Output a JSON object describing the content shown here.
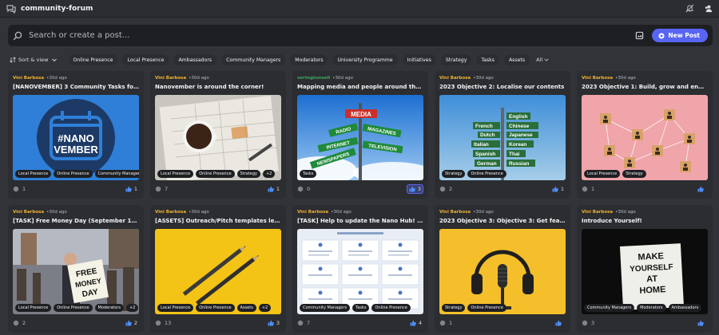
{
  "header": {
    "title": "community-forum"
  },
  "search": {
    "placeholder": "Search or create a post...",
    "new_post_label": "New Post"
  },
  "toolbar": {
    "sort_label": "Sort & view",
    "tags": [
      "Online Presence",
      "Local Presence",
      "Ambassadors",
      "Community Managers",
      "Moderators",
      "University Programme",
      "Initiatives",
      "Strategy",
      "Tasks",
      "Assets"
    ],
    "all_label": "All"
  },
  "posts": [
    {
      "author": "Vini Barbosa",
      "time": "30d ago",
      "title": "[NANOVEMBER] 3 Community Tasks for Everyo...",
      "tags": [
        "Local Presence",
        "Online Presence",
        "Community Managers"
      ],
      "comments": "1",
      "likes": "1",
      "thumb_text": [
        "#NANO",
        "VEMBER"
      ]
    },
    {
      "author": "Vini Barbosa",
      "time": "30d ago",
      "title": "Nanovember is around the corner!",
      "tags": [
        "Local Presence",
        "Online Presence",
        "Strategy",
        "+2"
      ],
      "comments": "7",
      "likes": "1"
    },
    {
      "author": "sertogtunsell",
      "time": "30d ago",
      "title": "Mapping media and people around the world",
      "tags": [
        "Tasks"
      ],
      "comments": "0",
      "likes": "3",
      "thumb_text": [
        "MEDIA",
        "RADIO",
        "MAGAZINES",
        "INTERNET",
        "TELEVISION",
        "NEWSPAPERS"
      ]
    },
    {
      "author": "Vini Barbosa",
      "time": "30d ago",
      "title": "2023 Objective 2: Localise our contents",
      "tags": [
        "Strategy",
        "Online Presence"
      ],
      "comments": "2",
      "likes": "1",
      "thumb_text": [
        "French",
        "English",
        "Chinese",
        "Dutch",
        "Japanese",
        "Italian",
        "Korean",
        "Spanish",
        "Thai",
        "German",
        "Russian"
      ]
    },
    {
      "author": "Vini Barbosa",
      "time": "30d ago",
      "title": "2023 Objective 1: Build, grow and engage your c...",
      "tags": [
        "Local Presence",
        "Strategy"
      ],
      "comments": "1",
      "likes": ""
    },
    {
      "author": "Vini Barbosa",
      "time": "30d ago",
      "title": "[TASK] Free Money Day (September 15, Friday)",
      "tags": [
        "Local Presence",
        "Online Presence",
        "Moderators",
        "+2"
      ],
      "comments": "2",
      "likes": "2",
      "thumb_text": [
        "FREE",
        "MONEY",
        "DAY"
      ]
    },
    {
      "author": "Vini Barbosa",
      "time": "30d ago",
      "title": "[ASSETS] Outreach/Pitch templates lead gener...",
      "tags": [
        "Local Presence",
        "Online Presence",
        "Assets",
        "+2"
      ],
      "comments": "13",
      "likes": "3"
    },
    {
      "author": "Vini Barbosa",
      "time": "30d ago",
      "title": "[TASK] Help to update the Nano Hub! (see how)",
      "tags": [
        "Community Managers",
        "Tasks",
        "Online Presence"
      ],
      "comments": "7",
      "likes": "4"
    },
    {
      "author": "Vini Barbosa",
      "time": "30d ago",
      "title": "2023 Objective 3: Objective 3: Get featured in 5...",
      "tags": [
        "Strategy",
        "Online Presence"
      ],
      "comments": "1",
      "likes": ""
    },
    {
      "author": "Vini Barbosa",
      "time": "30d ago",
      "title": "Introduce Yourself!",
      "tags": [
        "Community Managers",
        "Moderators",
        "Ambassadors"
      ],
      "comments": "3",
      "likes": "",
      "thumb_text": [
        "MAKE",
        "YOURSELF",
        "AT",
        "HOME"
      ]
    }
  ],
  "colors": {
    "accent": "#5865f2",
    "author": "#f0b232",
    "author_alt": "#3ba55c"
  }
}
